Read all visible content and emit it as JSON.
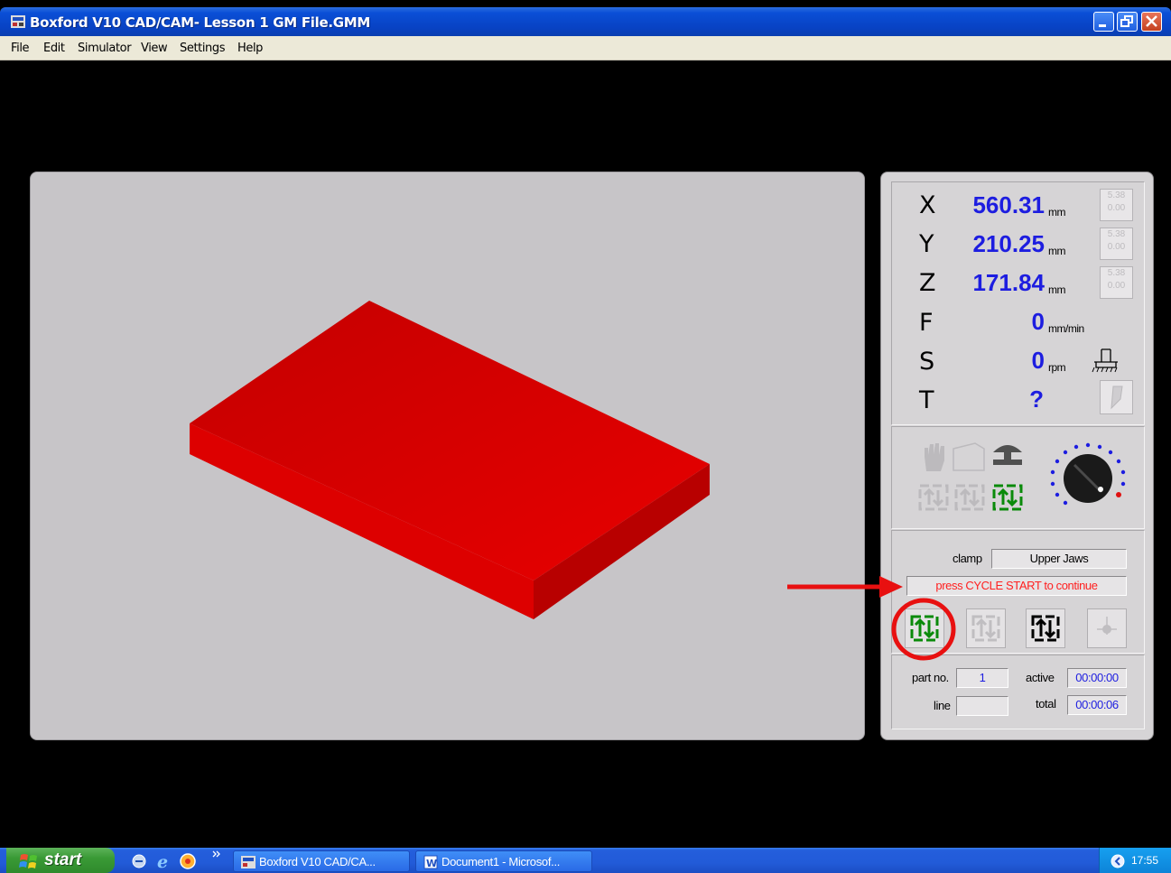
{
  "window": {
    "title": "Boxford V10 CAD/CAM- Lesson 1 GM File.GMM",
    "menu": [
      "File",
      "Edit",
      "Simulator",
      "View",
      "Settings",
      "Help"
    ]
  },
  "dro": {
    "x": {
      "label": "X",
      "value": "560.31",
      "unit": "mm",
      "btn_top": "5.38",
      "btn_bottom": "0.00"
    },
    "y": {
      "label": "Y",
      "value": "210.25",
      "unit": "mm",
      "btn_top": "5.38",
      "btn_bottom": "0.00"
    },
    "z": {
      "label": "Z",
      "value": "171.84",
      "unit": "mm",
      "btn_top": "5.38",
      "btn_bottom": "0.00"
    },
    "f": {
      "label": "F",
      "value": "0",
      "unit": "mm/min"
    },
    "s": {
      "label": "S",
      "value": "0",
      "unit": "rpm"
    },
    "t": {
      "label": "T",
      "value": "?"
    }
  },
  "status": {
    "clamp_label": "clamp",
    "clamp_value": "Upper Jaws",
    "message": "press CYCLE START to continue"
  },
  "counters": {
    "part_no_label": "part no.",
    "part_no_value": "1",
    "line_label": "line",
    "line_value": "",
    "active_label": "active",
    "active_value": "00:00:00",
    "total_label": "total",
    "total_value": "00:00:06"
  },
  "taskbar": {
    "start_label": "start",
    "tasks": [
      "Boxford V10 CAD/CA...",
      "Document1 - Microsof..."
    ],
    "clock": "17:55"
  },
  "colors": {
    "workpiece": "#e00000",
    "dro_value": "#1d1de0",
    "message": "#ff2020",
    "annotation": "#e81010",
    "cycle_green": "#0a8a0a"
  }
}
